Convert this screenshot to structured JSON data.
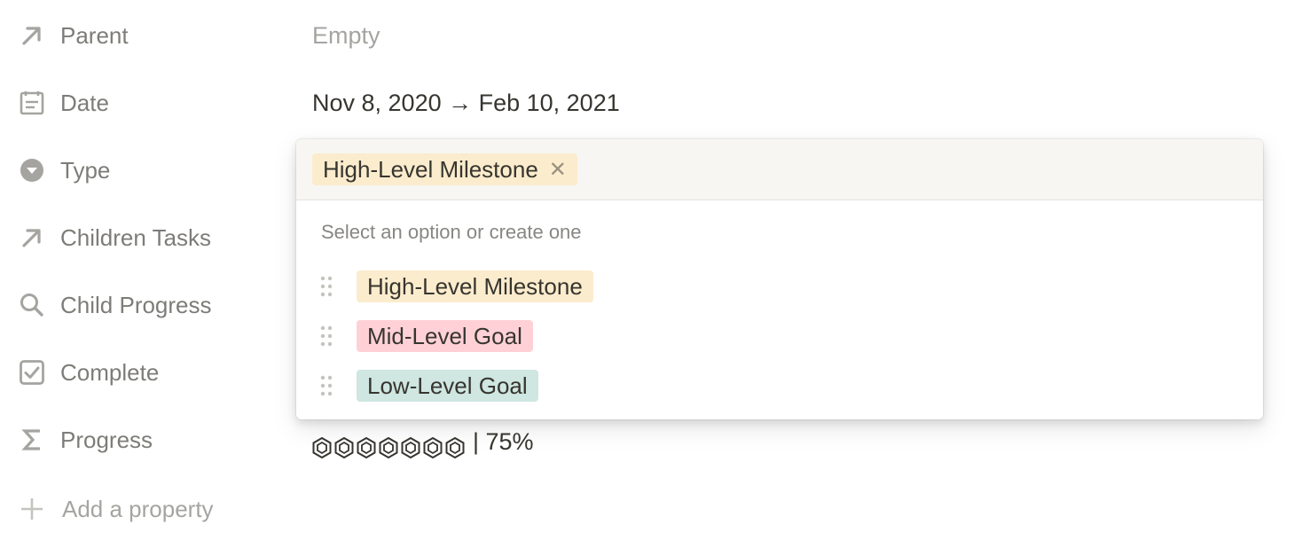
{
  "properties": [
    {
      "icon": "relation-arrow-icon",
      "label": "Parent"
    },
    {
      "icon": "calendar-icon",
      "label": "Date"
    },
    {
      "icon": "select-icon",
      "label": "Type"
    },
    {
      "icon": "relation-arrow-icon",
      "label": "Children Tasks"
    },
    {
      "icon": "search-icon",
      "label": "Child Progress"
    },
    {
      "icon": "checkbox-icon",
      "label": "Complete"
    },
    {
      "icon": "sigma-icon",
      "label": "Progress"
    }
  ],
  "values": {
    "parent": "Empty",
    "date": "Nov 8, 2020 → Feb 10, 2021",
    "progress_hexes": "⏣⏣⏣⏣⏣⏣⏣",
    "progress_text": "| 75%"
  },
  "add_property": {
    "icon": "plus-icon",
    "label": "Add a property"
  },
  "dropdown": {
    "selected": {
      "label": "High-Level Milestone",
      "color": "#fbeccd",
      "remove_icon": "close-icon"
    },
    "hint": "Select an option or create one",
    "options": [
      {
        "label": "High-Level Milestone",
        "color": "#fbeccd"
      },
      {
        "label": "Mid-Level Goal",
        "color": "#ffd1d6"
      },
      {
        "label": "Low-Level Goal",
        "color": "#cfe6e1"
      }
    ]
  }
}
